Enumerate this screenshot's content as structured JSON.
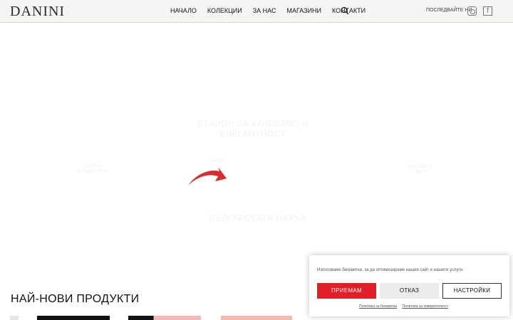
{
  "header": {
    "logo_text": "DANINI",
    "nav": [
      "НАЧАЛО",
      "КОЛЕКЦИИ",
      "ЗА НАС",
      "МАГАЗИНИ",
      "КОНТАКТИ"
    ],
    "follow_text": "ПОСЛЕДВАЙТЕ НИ",
    "facebook_glyph": "f"
  },
  "hero": {
    "headline": "ЕТАЛОН ЗА КАЧЕСТВО И ЕЛЕГАНТНОСТ",
    "subline": "БЪЛГАРСКАТА МАРКА",
    "left_caption": "СТИЛ И ИЗЯЩЕСТВО",
    "center_caption": "DANINI",
    "right_caption": "НИСКАТА ЦЕНА",
    "accent_color": "#d62e2e"
  },
  "products": {
    "title": "НАЙ-НОВИ ПРОДУКТИ"
  },
  "cookie": {
    "text": "Използваме бисквитки, за да оптимизираме нашия сайт и нашите услуги.",
    "accept": "ПРИЕМАМ",
    "deny": "ОТКАЗ",
    "settings": "НАСТРОЙКИ",
    "link_policy": "Политика за бисквитки",
    "link_privacy": "Политика за поверителност"
  }
}
